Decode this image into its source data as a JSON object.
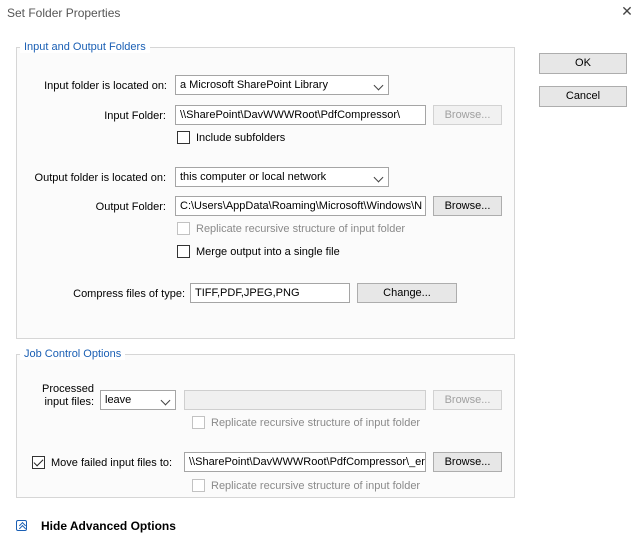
{
  "dialog": {
    "title": "Set Folder Properties",
    "close_glyph": "✕"
  },
  "buttons": {
    "ok": "OK",
    "cancel": "Cancel"
  },
  "io_group": {
    "legend": "Input and Output Folders",
    "input_location_label": "Input folder is located on:",
    "input_location_value": "a Microsoft SharePoint Library",
    "input_folder_label": "Input Folder:",
    "input_folder_value": "\\\\SharePoint\\DavWWWRoot\\PdfCompressor\\",
    "input_browse": "Browse...",
    "include_subfolders_label": "Include subfolders",
    "include_subfolders_checked": false,
    "output_location_label": "Output folder is located on:",
    "output_location_value": "this computer or local network",
    "output_folder_label": "Output Folder:",
    "output_folder_value": "C:\\Users\\AppData\\Roaming\\Microsoft\\Windows\\N",
    "output_browse": "Browse...",
    "replicate_label": "Replicate recursive structure of input folder",
    "replicate_checked": false,
    "merge_label": "Merge output into a single file",
    "merge_checked": false,
    "compress_label": "Compress files of type:",
    "compress_value": "TIFF,PDF,JPEG,PNG",
    "change_button": "Change..."
  },
  "job_group": {
    "legend": "Job Control Options",
    "processed_label_line1": "Processed",
    "processed_label_line2": "input files:",
    "processed_value": "leave",
    "processed_browse": "Browse...",
    "processed_replicate_label": "Replicate recursive structure of input folder",
    "move_failed_label": "Move failed input files to:",
    "move_failed_checked": true,
    "move_failed_value": "\\\\SharePoint\\DavWWWRoot\\PdfCompressor\\_err",
    "move_failed_browse": "Browse...",
    "failed_replicate_label": "Replicate recursive structure of input folder"
  },
  "advanced": {
    "label": "Hide Advanced Options"
  },
  "colors": {
    "accent": "#1a5fb4",
    "group_border": "#d6d6d6",
    "button_face": "#e7e7e7"
  }
}
